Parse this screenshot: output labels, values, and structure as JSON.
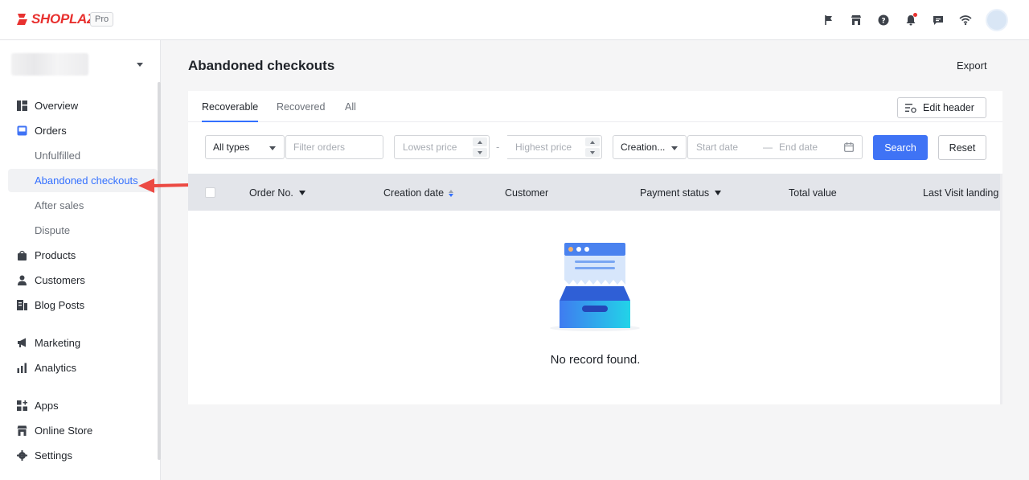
{
  "brand": {
    "name": "SHOPLAZZA",
    "badge": "Pro"
  },
  "topbar": {
    "icons": [
      "flag-icon",
      "store-icon",
      "help-icon",
      "bell-icon",
      "chat-icon",
      "wifi-icon"
    ]
  },
  "sidebar": {
    "items": [
      {
        "label": "Overview",
        "icon": "overview-icon"
      },
      {
        "label": "Orders",
        "icon": "orders-icon"
      },
      {
        "label": "Unfulfilled"
      },
      {
        "label": "Abandoned checkouts"
      },
      {
        "label": "After sales"
      },
      {
        "label": "Dispute"
      },
      {
        "label": "Products",
        "icon": "bag-icon"
      },
      {
        "label": "Customers",
        "icon": "person-icon"
      },
      {
        "label": "Blog Posts",
        "icon": "blog-icon"
      },
      {
        "label": "Marketing",
        "icon": "megaphone-icon"
      },
      {
        "label": "Analytics",
        "icon": "bar-chart-icon"
      },
      {
        "label": "Apps",
        "icon": "apps-icon"
      },
      {
        "label": "Online Store",
        "icon": "store-icon"
      },
      {
        "label": "Settings",
        "icon": "gear-icon"
      }
    ]
  },
  "page": {
    "title": "Abandoned checkouts",
    "export_label": "Export"
  },
  "tabs": [
    "Recoverable",
    "Recovered",
    "All"
  ],
  "edit_header_label": "Edit header",
  "filters": {
    "type_value": "All types",
    "filter_placeholder": "Filter orders",
    "lowest_placeholder": "Lowest price",
    "range_separator": "-",
    "highest_placeholder": "Highest price",
    "date_type_value": "Creation...",
    "start_placeholder": "Start date",
    "date_separator": "—",
    "end_placeholder": "End date",
    "search_label": "Search",
    "reset_label": "Reset"
  },
  "table": {
    "columns": [
      "Order No.",
      "Creation date",
      "Customer",
      "Payment status",
      "Total value",
      "Last Visit landing"
    ],
    "empty_text": "No record found."
  },
  "colors": {
    "accent": "#3f73f5",
    "brand": "#e8312f"
  }
}
